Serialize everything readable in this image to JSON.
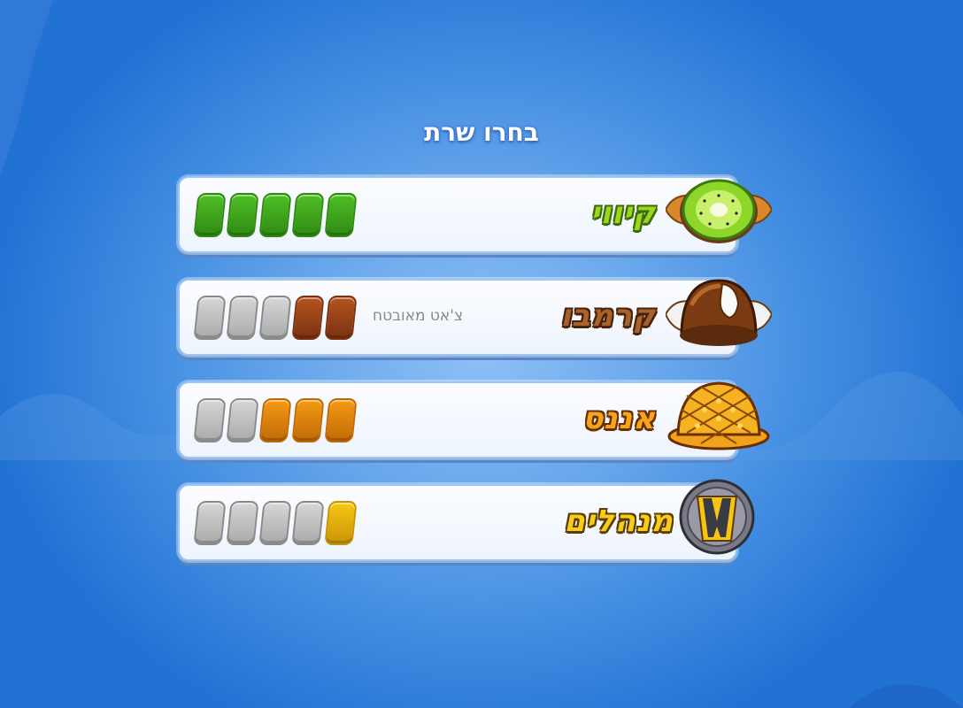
{
  "title": "בחרו שרת",
  "servers": [
    {
      "name": "קיווי",
      "subtitle": "",
      "emblem": "kiwi-icon",
      "level": 5,
      "max_level": 5,
      "color": "#4fbf26",
      "dark": "#2f8a12",
      "text_color": "#9ad81c",
      "outline": "#3d6a10"
    },
    {
      "name": "קרמבו",
      "subtitle": "צ'אט מאובטח",
      "emblem": "krembo-icon",
      "level": 2,
      "max_level": 5,
      "color": "#b5531f",
      "dark": "#7a3210",
      "text_color": "#a8622c",
      "outline": "#4a230c"
    },
    {
      "name": "אננס",
      "subtitle": "",
      "emblem": "pineapple-icon",
      "level": 3,
      "max_level": 5,
      "color": "#f59a14",
      "dark": "#c06a06",
      "text_color": "#f3a51b",
      "outline": "#6a2e06"
    },
    {
      "name": "מנהלים",
      "subtitle": "",
      "emblem": "admin-shield-icon",
      "level": 1,
      "max_level": 5,
      "color": "#f7c814",
      "dark": "#c89406",
      "text_color": "#f7cc1a",
      "outline": "#5a3d06"
    }
  ]
}
